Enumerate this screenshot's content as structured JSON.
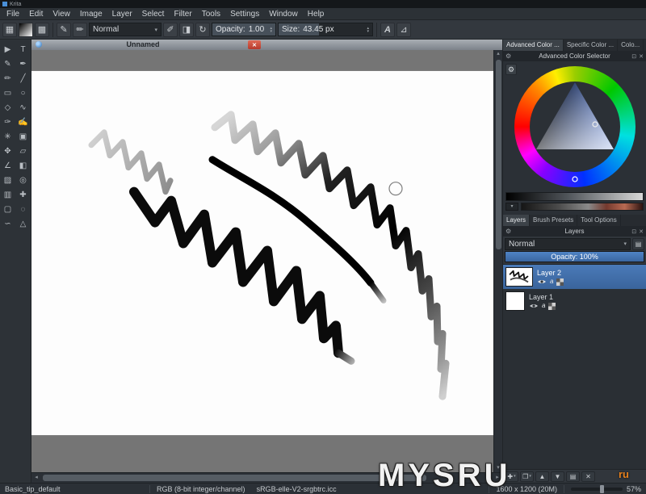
{
  "window": {
    "app_title": "Krita"
  },
  "menu": {
    "items": [
      "File",
      "Edit",
      "View",
      "Image",
      "Layer",
      "Select",
      "Filter",
      "Tools",
      "Settings",
      "Window",
      "Help"
    ]
  },
  "toolbar": {
    "blend_mode": "Normal",
    "opacity_label": "Opacity:",
    "opacity_value": "1.00",
    "size_label": "Size:",
    "size_value": "43.45 px"
  },
  "icons": {
    "workspace": "▦",
    "pattern": "▩",
    "brush_editor": "✎",
    "brush_preset": "✏",
    "paintop_a": "✐",
    "paintop_b": "◨",
    "reload": "↻",
    "dropdown": "▾",
    "spin_up": "▴",
    "spin_down": "▾",
    "mirror_h": "A",
    "mirror_v": "⊿",
    "scroll_left": "◂",
    "scroll_right": "▸",
    "scroll_up": "▴",
    "scroll_down": "▾",
    "float": "⊡",
    "close": "✕",
    "gear": "⚙",
    "menu_list": "▤",
    "plus": "✚",
    "duplicate": "❐",
    "up": "▲",
    "down": "▼",
    "properties": "▤",
    "delete": "✕",
    "alpha": "a"
  },
  "left_tools": [
    {
      "name": "select-shapes",
      "glyph": "▶"
    },
    {
      "name": "text",
      "glyph": "T"
    },
    {
      "name": "edit-shapes",
      "glyph": "✎"
    },
    {
      "name": "calligraphy",
      "glyph": "✒"
    },
    {
      "name": "pencil",
      "glyph": "✏"
    },
    {
      "name": "line",
      "glyph": "╱"
    },
    {
      "name": "rectangle",
      "glyph": "▭"
    },
    {
      "name": "ellipse",
      "glyph": "○"
    },
    {
      "name": "polygon",
      "glyph": "◇"
    },
    {
      "name": "polyline",
      "glyph": "∿"
    },
    {
      "name": "freehand-brush",
      "glyph": "✑"
    },
    {
      "name": "dynamic-brush",
      "glyph": "✍"
    },
    {
      "name": "multibrush",
      "glyph": "✳"
    },
    {
      "name": "crop",
      "glyph": "▣"
    },
    {
      "name": "move",
      "glyph": "✥"
    },
    {
      "name": "transform",
      "glyph": "▱"
    },
    {
      "name": "measure",
      "glyph": "∠"
    },
    {
      "name": "fill",
      "glyph": "◧"
    },
    {
      "name": "gradient",
      "glyph": "▨"
    },
    {
      "name": "color-picker",
      "glyph": "◎"
    },
    {
      "name": "pattern-edit",
      "glyph": "▥"
    },
    {
      "name": "assistant",
      "glyph": "✚"
    },
    {
      "name": "select-rectangular",
      "glyph": "▢"
    },
    {
      "name": "select-elliptical",
      "glyph": "◌"
    },
    {
      "name": "select-freehand",
      "glyph": "∽"
    },
    {
      "name": "select-polygonal",
      "glyph": "△"
    }
  ],
  "document": {
    "tab_title": "Unnamed"
  },
  "color_docker": {
    "tabs": [
      "Advanced Color ...",
      "Specific Color ...",
      "Colo..."
    ],
    "title": "Advanced Color Selector"
  },
  "layers_docker": {
    "tabs": [
      "Layers",
      "Brush Presets",
      "Tool Options"
    ],
    "title": "Layers",
    "blend_mode": "Normal",
    "opacity_text": "Opacity: 100%",
    "layers": [
      {
        "name": "Layer 2",
        "selected": true
      },
      {
        "name": "Layer 1",
        "selected": false
      }
    ]
  },
  "statusbar": {
    "preset": "Basic_tip_default",
    "colorspace": "RGB (8-bit integer/channel)",
    "profile": "sRGB-elle-V2-srgbtrc.icc",
    "dimensions": "1600 x 1200 (20M)",
    "zoom": "57%"
  },
  "watermark": {
    "text": "MYSRU",
    "suffix": "ru"
  },
  "colors": {
    "selection_blue": "#3d6ea6",
    "close_red": "#c8473a",
    "watermark_orange": "#e8821e",
    "canvas_gray": "#757575",
    "accent_hue": "#5b7fd4"
  }
}
